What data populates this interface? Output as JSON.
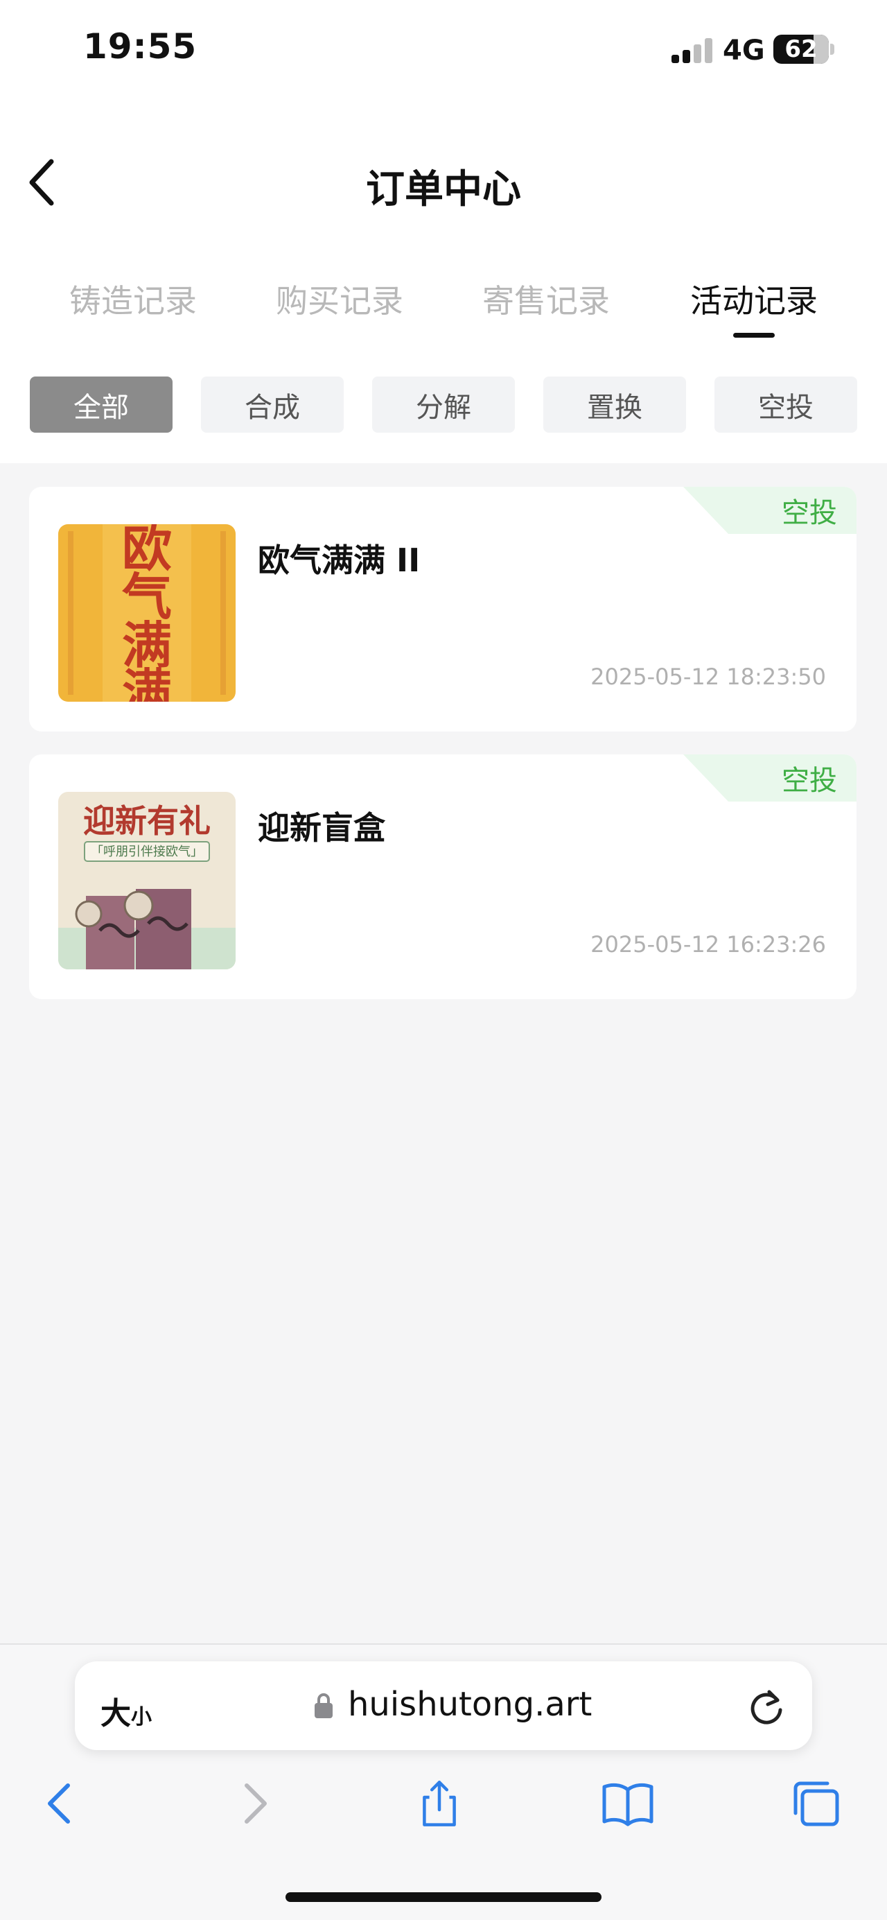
{
  "status_bar": {
    "time": "19:55",
    "network": "4G",
    "battery": "62"
  },
  "header": {
    "title": "订单中心"
  },
  "tabs": [
    {
      "label": "铸造记录",
      "active": false
    },
    {
      "label": "购买记录",
      "active": false
    },
    {
      "label": "寄售记录",
      "active": false
    },
    {
      "label": "活动记录",
      "active": true
    }
  ],
  "filters": [
    {
      "label": "全部",
      "active": true
    },
    {
      "label": "合成",
      "active": false
    },
    {
      "label": "分解",
      "active": false
    },
    {
      "label": "置换",
      "active": false
    },
    {
      "label": "空投",
      "active": false
    }
  ],
  "records": [
    {
      "title": "欧气满满 II",
      "badge": "空投",
      "time": "2025-05-12 18:23:50",
      "thumb_text": "欧气满满"
    },
    {
      "title": "迎新盲盒",
      "badge": "空投",
      "time": "2025-05-12 16:23:26",
      "thumb_title": "迎新有礼",
      "thumb_subtitle": "「呼朋引伴接欧气」"
    }
  ],
  "browser": {
    "text_size_label": "大",
    "text_size_small": "小",
    "url": "huishutong.art"
  },
  "colors": {
    "badge_green": "#3fae45",
    "badge_bg": "#e9f8ec",
    "chip_active": "#8b8b8b",
    "link_blue": "#2f7fe8"
  }
}
